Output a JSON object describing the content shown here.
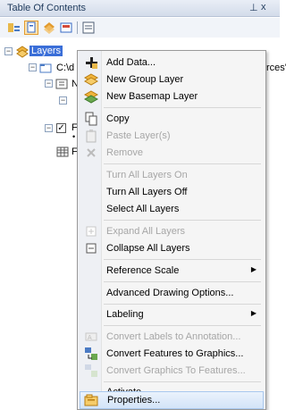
{
  "panel": {
    "title": "Table Of Contents",
    "pin_glyph": "⊥",
    "close_glyph": "x"
  },
  "toolbar": {
    "icons": [
      "list-by-drawing-order-icon",
      "list-by-source-icon",
      "list-by-visibility-icon",
      "list-by-selection-icon",
      "options-icon"
    ]
  },
  "tree": {
    "layers_label": "Layers",
    "folder_path_partial": "C:\\d",
    "right_clip_text": "rces'",
    "group_label_partial": "N",
    "layer_label_partial": "F",
    "row_label_partial": "F"
  },
  "context_menu": {
    "items": [
      {
        "label": "Add Data...",
        "icon": "add-data-icon",
        "enabled": true
      },
      {
        "label": "New Group Layer",
        "icon": "group-layer-icon",
        "enabled": true
      },
      {
        "label": "New Basemap Layer",
        "icon": "basemap-layer-icon",
        "enabled": true
      },
      {
        "label": "Copy",
        "icon": "copy-icon",
        "enabled": true
      },
      {
        "label": "Paste Layer(s)",
        "icon": "paste-icon",
        "enabled": false
      },
      {
        "label": "Remove",
        "icon": "remove-icon",
        "enabled": false
      },
      {
        "label": "Turn All Layers On",
        "icon": "",
        "enabled": false
      },
      {
        "label": "Turn All Layers Off",
        "icon": "",
        "enabled": true
      },
      {
        "label": "Select All Layers",
        "icon": "",
        "enabled": true
      },
      {
        "label": "Expand All Layers",
        "icon": "expand-icon",
        "enabled": false
      },
      {
        "label": "Collapse All Layers",
        "icon": "collapse-icon",
        "enabled": true
      },
      {
        "label": "Reference Scale",
        "icon": "",
        "enabled": true,
        "submenu": true
      },
      {
        "label": "Advanced Drawing Options...",
        "icon": "",
        "enabled": true
      },
      {
        "label": "Labeling",
        "icon": "",
        "enabled": true,
        "submenu": true
      },
      {
        "label": "Convert Labels to Annotation...",
        "icon": "convert-labels-icon",
        "enabled": false
      },
      {
        "label": "Convert Features to Graphics...",
        "icon": "convert-features-icon",
        "enabled": true
      },
      {
        "label": "Convert Graphics To Features...",
        "icon": "convert-graphics-icon",
        "enabled": false
      },
      {
        "label": "Activate",
        "icon": "",
        "enabled": true
      },
      {
        "label": "Properties...",
        "icon": "properties-icon",
        "enabled": true,
        "highlighted": true
      }
    ],
    "submenu_glyph": "▶"
  }
}
